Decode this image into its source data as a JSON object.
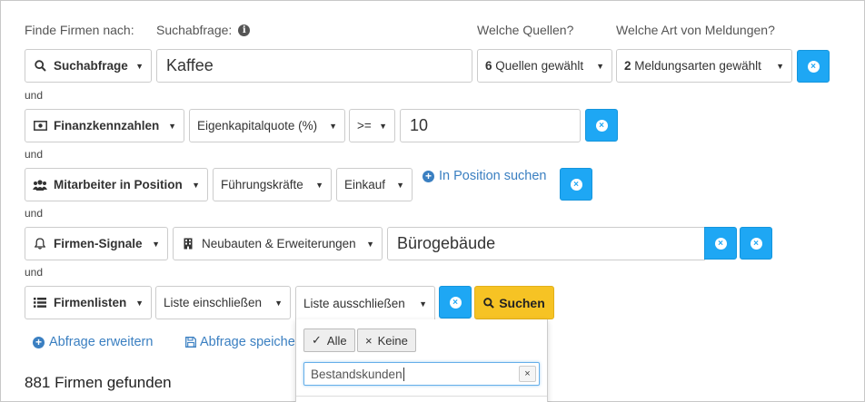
{
  "headers": {
    "finde": "Finde Firmen nach:",
    "suchabfrage": "Suchabfrage:",
    "quellen": "Welche Quellen?",
    "meldungen": "Welche Art von Meldungen?"
  },
  "row1": {
    "type_label": "Suchabfrage",
    "query_value": "Kaffee",
    "sources_count": "6",
    "sources_label": "Quellen gewählt",
    "types_count": "2",
    "types_label": "Meldungsarten gewählt"
  },
  "row2": {
    "type_label": "Finanzkennzahlen",
    "metric": "Eigenkapitalquote (%)",
    "operator": ">=",
    "value": "10"
  },
  "row3": {
    "type_label": "Mitarbeiter in Position",
    "level": "Führungskräfte",
    "department": "Einkauf",
    "link": "In Position suchen"
  },
  "row4": {
    "type_label": "Firmen-Signale",
    "signal": "Neubauten & Erweiterungen",
    "value": "Bürogebäude"
  },
  "row5": {
    "type_label": "Firmenlisten",
    "include": "Liste einschließen",
    "exclude": "Liste ausschließen",
    "search_label": "Suchen"
  },
  "connector": "und",
  "dropdown": {
    "all_label": "Alle",
    "none_label": "Keine",
    "filter_value": "Bestandskunden"
  },
  "links": {
    "expand": "Abfrage erweitern",
    "save": "Abfrage speiche"
  },
  "result": "881 Firmen gefunden",
  "colors": {
    "accent_blue": "#1ea7f4",
    "search_yellow": "#f6c324",
    "link_blue": "#3a7fc1"
  }
}
